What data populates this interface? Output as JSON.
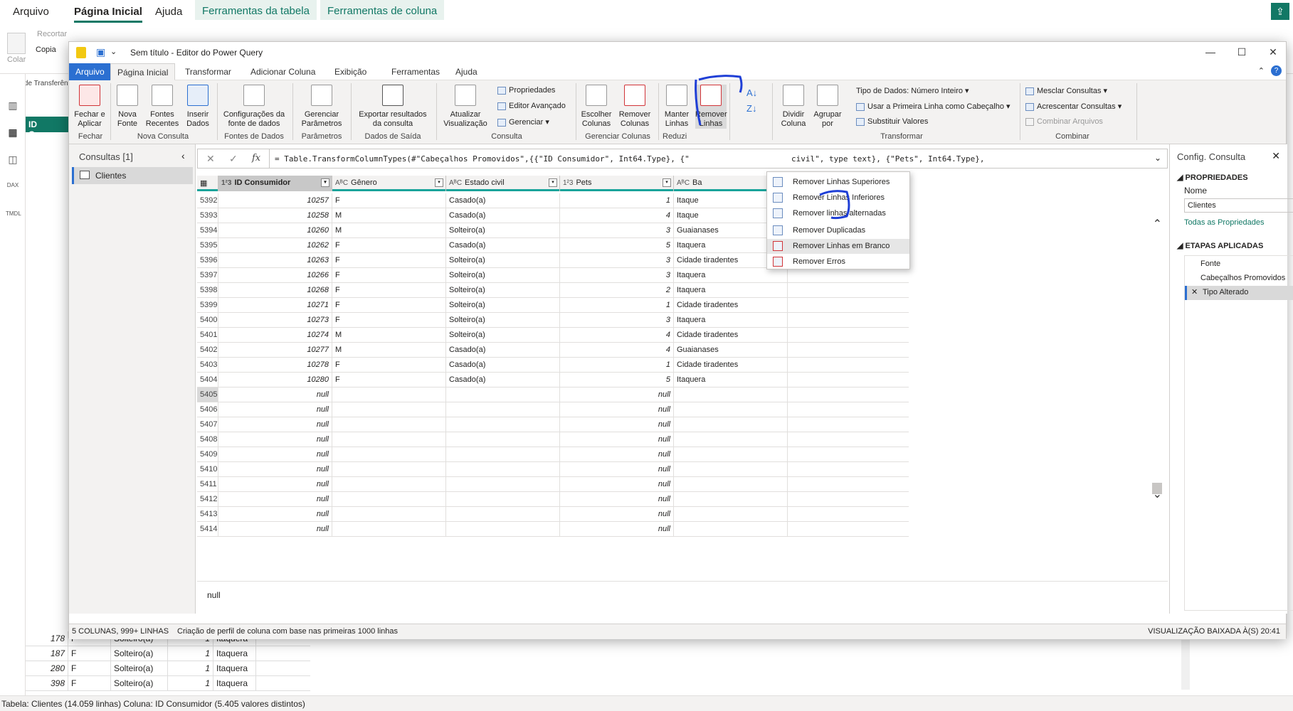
{
  "pbi": {
    "tabs": [
      "Arquivo",
      "Página Inicial",
      "Ajuda",
      "Ferramentas da tabela",
      "Ferramentas de coluna"
    ],
    "ribbon": {
      "colar": "Colar",
      "recortar": "Recortar",
      "copiar": "Copia",
      "area_transferencia": "Área de Transferên"
    },
    "column_header": "ID Consum",
    "bottom_rows": [
      [
        "178",
        "F",
        "Solteiro(a)",
        "1",
        "Itaquera"
      ],
      [
        "187",
        "F",
        "Solteiro(a)",
        "1",
        "Itaquera"
      ],
      [
        "280",
        "F",
        "Solteiro(a)",
        "1",
        "Itaquera"
      ],
      [
        "398",
        "F",
        "Solteiro(a)",
        "1",
        "Itaquera"
      ]
    ],
    "status": "Tabela: Clientes (14.059 linhas) Coluna: ID Consumidor (5.405 valores distintos)"
  },
  "pq": {
    "title": "Sem título - Editor do Power Query",
    "tabs": [
      "Arquivo",
      "Página Inicial",
      "Transformar",
      "Adicionar Coluna",
      "Exibição",
      "Ferramentas",
      "Ajuda"
    ],
    "ribbon": {
      "fechar_aplicar": "Fechar e\nAplicar",
      "nova_fonte": "Nova\nFonte",
      "fontes_recentes": "Fontes\nRecentes",
      "inserir_dados": "Inserir\nDados",
      "config_fonte": "Configurações da\nfonte de dados",
      "gerenciar_param": "Gerenciar\nParâmetros",
      "exportar": "Exportar resultados\nda consulta",
      "atualizar": "Atualizar\nVisualização",
      "propriedades": "Propriedades",
      "editor_avancado": "Editor Avançado",
      "gerenciar": "Gerenciar",
      "escolher_colunas": "Escolher\nColunas",
      "remover_colunas": "Remover\nColunas",
      "manter_linhas": "Manter\nLinhas",
      "remover_linhas": "Remover\nLinhas",
      "dividir_coluna": "Dividir\nColuna",
      "agrupar_por": "Agrupar\npor",
      "tipo_dados": "Tipo de Dados: Número Inteiro",
      "primeira_linha": "Usar a Primeira Linha como Cabeçalho",
      "substituir": "Substituir Valores",
      "mesclar": "Mesclar Consultas",
      "acrescentar": "Acrescentar Consultas",
      "combinar_arquivos": "Combinar Arquivos",
      "groups": {
        "fechar": "Fechar",
        "nova_consulta": "Nova Consulta",
        "fontes_dados": "Fontes de Dados",
        "parametros": "Parâmetros",
        "dados_saida": "Dados de Saída",
        "consulta": "Consulta",
        "gerenciar_colunas": "Gerenciar Colunas",
        "reduzir": "Reduzi",
        "transformar": "Transformar",
        "combinar": "Combinar"
      }
    },
    "queries": {
      "title": "Consultas [1]",
      "item": "Clientes"
    },
    "formula": "= Table.TransformColumnTypes(#\"Cabeçalhos Promovidos\",{{\"ID Consumidor\", Int64.Type}, {\"",
    "formula_tail": "civil\", type text}, {\"Pets\", Int64.Type},",
    "fx": "fx",
    "columns": [
      {
        "type": "1²3",
        "name": "ID Consumidor"
      },
      {
        "type": "AᴮC",
        "name": "Gênero"
      },
      {
        "type": "AᴮC",
        "name": "Estado civil"
      },
      {
        "type": "1²3",
        "name": "Pets"
      },
      {
        "type": "AᴮC",
        "name": "Ba"
      }
    ],
    "rows": [
      [
        "5392",
        "10257",
        "F",
        "Casado(a)",
        "1",
        "Itaque"
      ],
      [
        "5393",
        "10258",
        "M",
        "Casado(a)",
        "4",
        "Itaque"
      ],
      [
        "5394",
        "10260",
        "M",
        "Solteiro(a)",
        "3",
        "Guaianases"
      ],
      [
        "5395",
        "10262",
        "F",
        "Casado(a)",
        "5",
        "Itaquera"
      ],
      [
        "5396",
        "10263",
        "F",
        "Solteiro(a)",
        "3",
        "Cidade tiradentes"
      ],
      [
        "5397",
        "10266",
        "F",
        "Solteiro(a)",
        "3",
        "Itaquera"
      ],
      [
        "5398",
        "10268",
        "F",
        "Solteiro(a)",
        "2",
        "Itaquera"
      ],
      [
        "5399",
        "10271",
        "F",
        "Solteiro(a)",
        "1",
        "Cidade tiradentes"
      ],
      [
        "5400",
        "10273",
        "F",
        "Solteiro(a)",
        "3",
        "Itaquera"
      ],
      [
        "5401",
        "10274",
        "M",
        "Solteiro(a)",
        "4",
        "Cidade tiradentes"
      ],
      [
        "5402",
        "10277",
        "M",
        "Casado(a)",
        "4",
        "Guaianases"
      ],
      [
        "5403",
        "10278",
        "F",
        "Casado(a)",
        "1",
        "Cidade tiradentes"
      ],
      [
        "5404",
        "10280",
        "F",
        "Casado(a)",
        "5",
        "Itaquera"
      ],
      [
        "5405",
        "null",
        "",
        "",
        "null",
        ""
      ],
      [
        "5406",
        "null",
        "",
        "",
        "null",
        ""
      ],
      [
        "5407",
        "null",
        "",
        "",
        "null",
        ""
      ],
      [
        "5408",
        "null",
        "",
        "",
        "null",
        ""
      ],
      [
        "5409",
        "null",
        "",
        "",
        "null",
        ""
      ],
      [
        "5410",
        "null",
        "",
        "",
        "null",
        ""
      ],
      [
        "5411",
        "null",
        "",
        "",
        "null",
        ""
      ],
      [
        "5412",
        "null",
        "",
        "",
        "null",
        ""
      ],
      [
        "5413",
        "null",
        "",
        "",
        "null",
        ""
      ],
      [
        "5414",
        "null",
        "",
        "",
        "null",
        ""
      ]
    ],
    "preview_value": "null",
    "right": {
      "title": "Config. Consulta",
      "propriedades": "PROPRIEDADES",
      "nome_label": "Nome",
      "nome_value": "Clientes",
      "todas": "Todas as Propriedades",
      "etapas": "ETAPAS APLICADAS",
      "steps": [
        "Fonte",
        "Cabeçalhos Promovidos",
        "Tipo Alterado"
      ]
    },
    "status_left": "5 COLUNAS, 999+ LINHAS",
    "status_mid": "Criação de perfil de coluna com base nas primeiras 1000 linhas",
    "status_right": "VISUALIZAÇÃO BAIXADA À(S) 20:41",
    "menu": [
      "Remover Linhas Superiores",
      "Remover Linhas Inferiores",
      "Remover linhas alternadas",
      "Remover Duplicadas",
      "Remover Linhas em Branco",
      "Remover Erros"
    ]
  },
  "colors": {
    "accent": "#2b6fd1",
    "teal": "#1aa39a",
    "annotation": "#1f3fd6",
    "pbi_green": "#117865"
  }
}
